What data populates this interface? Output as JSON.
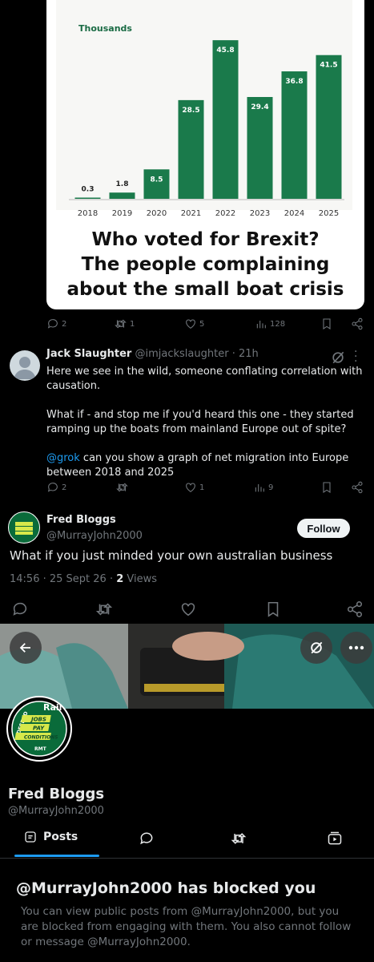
{
  "chart_data": {
    "type": "bar",
    "title": "",
    "unit_label": "Thousands",
    "categories": [
      "2018",
      "2019",
      "2020",
      "2021",
      "2022",
      "2023",
      "2024",
      "2025"
    ],
    "values": [
      0.3,
      1.8,
      8.5,
      28.5,
      45.8,
      29.4,
      36.8,
      41.5
    ],
    "ylim": [
      0,
      50
    ],
    "bar_color": "#1a7a4b",
    "grid": false
  },
  "headline_lines": [
    "Who voted for Brexit?",
    "The people complaining",
    "about the small boat crisis"
  ],
  "post_actions": {
    "replies": "2",
    "reposts": "1",
    "likes": "5",
    "views": "128"
  },
  "reply": {
    "name": "Jack Slaughter",
    "handle": "@imjackslaughter",
    "time": "· 21h",
    "p1": "Here we see in the wild, someone conflating correlation with causation.",
    "p2": "What if - and stop me if you'd heard this one - they started ramping up the boats from mainland Europe out of spite?",
    "mention": "@grok",
    "p3_rest": " can you show a graph of net migration into Europe between 2018 and 2025",
    "actions": {
      "replies": "2",
      "reposts": "",
      "likes": "1",
      "views": "9"
    }
  },
  "fred_tweet": {
    "name": "Fred Bloggs",
    "handle": "@MurrayJohn2000",
    "follow_label": "Follow",
    "text": "What if you just minded your own australian business",
    "timestamp": "14:56 · 25 Sept 26 · ",
    "views_count": "2",
    "views_label": " Views"
  },
  "logo": {
    "top": "Rail",
    "left": "DEFEND",
    "jobs": "JOBS",
    "pay": "PAY",
    "conditions": "CONDITIONS",
    "bottom": "RMT"
  },
  "profile": {
    "name": "Fred Bloggs",
    "handle": "@MurrayJohn2000",
    "tab_posts": "Posts"
  },
  "blocked": {
    "title": "@MurrayJohn2000 has blocked you",
    "body": "You can view public posts from @MurrayJohn2000, but you are blocked from engaging with them. You also cannot follow or message @MurrayJohn2000."
  },
  "colors": {
    "accent": "#1d9bf0",
    "muted": "#71767b",
    "background": "#000000"
  }
}
